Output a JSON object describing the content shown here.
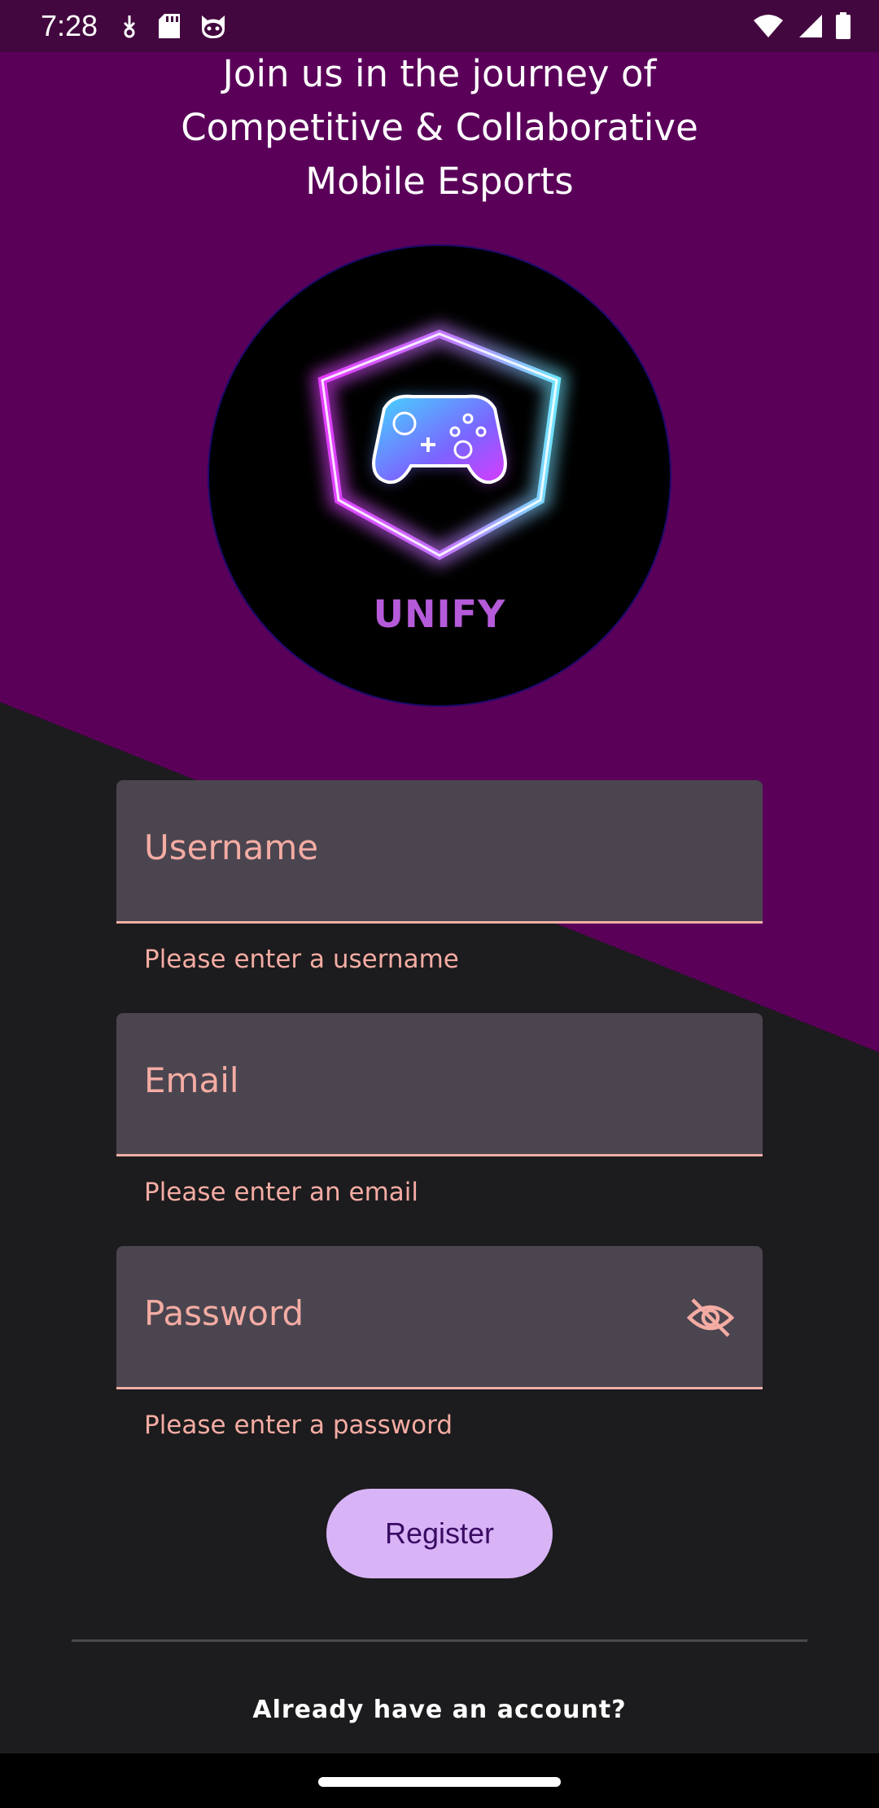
{
  "status_bar": {
    "time": "7:28",
    "left_icons": [
      "download-icon",
      "sd-card-icon",
      "cat-face-icon"
    ],
    "right_icons": [
      "wifi-icon",
      "signal-icon",
      "battery-icon"
    ]
  },
  "header": {
    "lines": [
      "Join us in the journey of",
      "Competitive & Collaborative",
      "Mobile Esports"
    ]
  },
  "logo": {
    "brand": "UNIFY",
    "icon": "game-controller-icon"
  },
  "form": {
    "username": {
      "placeholder": "Username",
      "error": "Please enter a username"
    },
    "email": {
      "placeholder": "Email",
      "error": "Please enter an email"
    },
    "password": {
      "placeholder": "Password",
      "error": "Please enter a password",
      "toggle_icon": "eye-off-icon"
    },
    "register_label": "Register"
  },
  "footer": {
    "login_prompt": "Already have an account?"
  },
  "colors": {
    "purple_background": "#5a0059",
    "dark_background": "#1c1b1d",
    "field_fill": "#4b4550",
    "error_text": "#f4aca3",
    "button_fill": "#d8b4f7",
    "button_text": "#3a0b63",
    "logo_text": "#b55bd9"
  }
}
